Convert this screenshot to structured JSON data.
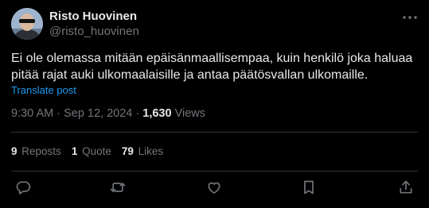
{
  "author": {
    "name": "Risto Huovinen",
    "handle": "@risto_huovinen"
  },
  "tweet": {
    "text": "Ei ole olemassa mitään epäisänmaallisempaa, kuin henkilö joka haluaa pitää rajat auki ulkomaalaisille ja antaa päätösvallan ulkomaille.",
    "translate_label": "Translate post",
    "time": "9:30 AM",
    "separator": " · ",
    "date": "Sep 12, 2024",
    "views_count": "1,630",
    "views_label": "Views"
  },
  "stats": {
    "reposts_count": "9",
    "reposts_label": "Reposts",
    "quotes_count": "1",
    "quotes_label": "Quote",
    "likes_count": "79",
    "likes_label": "Likes"
  },
  "icons": {
    "more": "more-icon",
    "reply": "reply-icon",
    "repost": "repost-icon",
    "like": "like-icon",
    "bookmark": "bookmark-icon",
    "share": "share-icon"
  },
  "colors": {
    "background": "#000000",
    "text": "#e7e9ea",
    "secondary": "#71767b",
    "link": "#1d9bf0",
    "divider": "#2f3336"
  }
}
